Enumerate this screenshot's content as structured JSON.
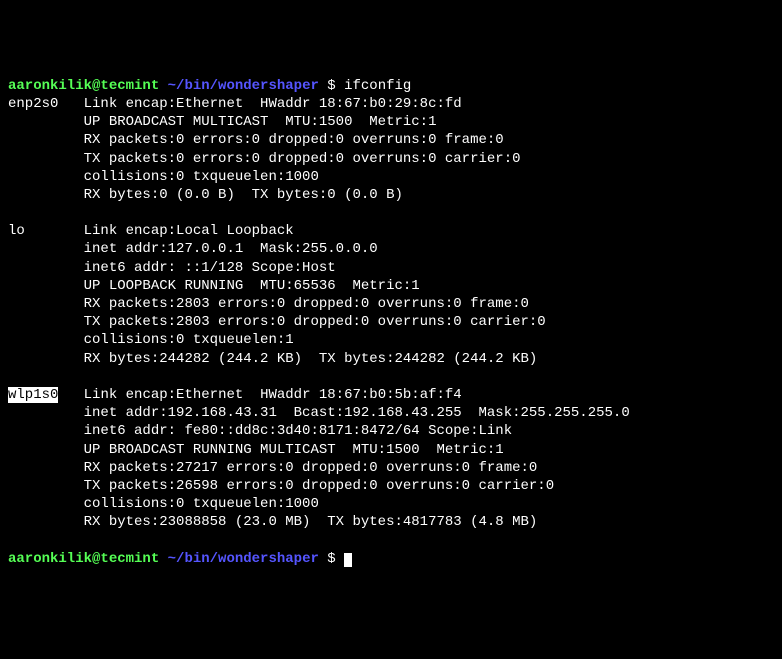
{
  "prompt": {
    "user": "aaronkilik@tecmint",
    "path": "~/bin/wondershaper",
    "symbol": "$"
  },
  "command": "ifconfig",
  "interfaces": [
    {
      "name": "enp2s0",
      "highlighted": false,
      "lines": [
        "Link encap:Ethernet  HWaddr 18:67:b0:29:8c:fd",
        "UP BROADCAST MULTICAST  MTU:1500  Metric:1",
        "RX packets:0 errors:0 dropped:0 overruns:0 frame:0",
        "TX packets:0 errors:0 dropped:0 overruns:0 carrier:0",
        "collisions:0 txqueuelen:1000",
        "RX bytes:0 (0.0 B)  TX bytes:0 (0.0 B)"
      ]
    },
    {
      "name": "lo",
      "highlighted": false,
      "lines": [
        "Link encap:Local Loopback",
        "inet addr:127.0.0.1  Mask:255.0.0.0",
        "inet6 addr: ::1/128 Scope:Host",
        "UP LOOPBACK RUNNING  MTU:65536  Metric:1",
        "RX packets:2803 errors:0 dropped:0 overruns:0 frame:0",
        "TX packets:2803 errors:0 dropped:0 overruns:0 carrier:0",
        "collisions:0 txqueuelen:1",
        "RX bytes:244282 (244.2 KB)  TX bytes:244282 (244.2 KB)"
      ]
    },
    {
      "name": "wlp1s0",
      "highlighted": true,
      "lines": [
        "Link encap:Ethernet  HWaddr 18:67:b0:5b:af:f4",
        "inet addr:192.168.43.31  Bcast:192.168.43.255  Mask:255.255.255.0",
        "inet6 addr: fe80::dd8c:3d40:8171:8472/64 Scope:Link",
        "UP BROADCAST RUNNING MULTICAST  MTU:1500  Metric:1",
        "RX packets:27217 errors:0 dropped:0 overruns:0 frame:0",
        "TX packets:26598 errors:0 dropped:0 overruns:0 carrier:0",
        "collisions:0 txqueuelen:1000",
        "RX bytes:23088858 (23.0 MB)  TX bytes:4817783 (4.8 MB)"
      ]
    }
  ]
}
